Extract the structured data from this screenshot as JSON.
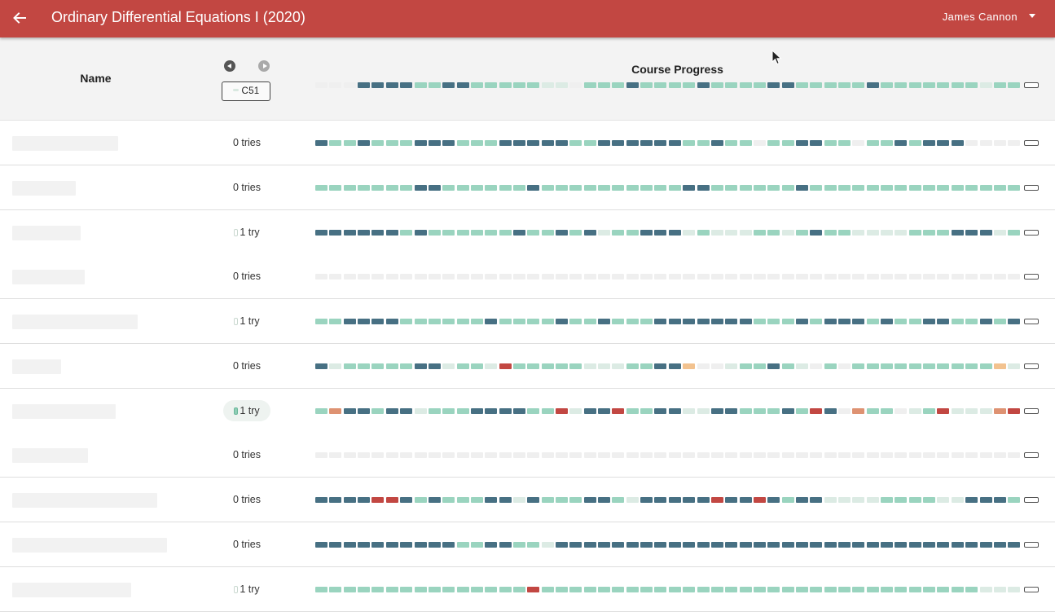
{
  "app": {
    "title": "Ordinary Differential Equations I (2020)",
    "user": "James Cannon"
  },
  "header": {
    "name_label": "Name",
    "progress_label": "Course Progress",
    "assignment_chip": "C51",
    "overall_progress": "0003333223322222110222322223222233222223222222212222222122221222111"
  },
  "students": [
    {
      "tries": "0 tries",
      "progress": "3223222333222333332233333322322022332202232333000000"
    },
    {
      "tries": "0 tries",
      "progress": "2222222332222223222222222233222222322222222222222222000"
    },
    {
      "tries": "1 try",
      "progress": "3333332322222232232312233312111221232211112223331222"
    },
    {
      "tries": "0 tries",
      "progress": "0000000000000000000000000000000000000000000000000000"
    },
    {
      "tries": "1 try",
      "progress": "2233332222223222232232223333333222323332322332232312222"
    },
    {
      "tries": "0 tries",
      "progress": "3122222331221422222111223350012232102022222222225110"
    },
    {
      "tries": "1 try",
      "progress": "2633233122233332241334223311332223243062201241116411522332"
    },
    {
      "tries": "0 tries",
      "progress": "0000000000000000000000000000000000000000000000000000"
    },
    {
      "tries": "0 tries",
      "progress": "3333443232223313222332133333433432331111222211333221200000"
    },
    {
      "tries": "0 tries",
      "progress": "3333333333223322133333333333333333333333333333333333333333300"
    },
    {
      "tries": "1 try",
      "progress": "2222222222222224222222222222222222222222222222211111111110"
    }
  ]
}
